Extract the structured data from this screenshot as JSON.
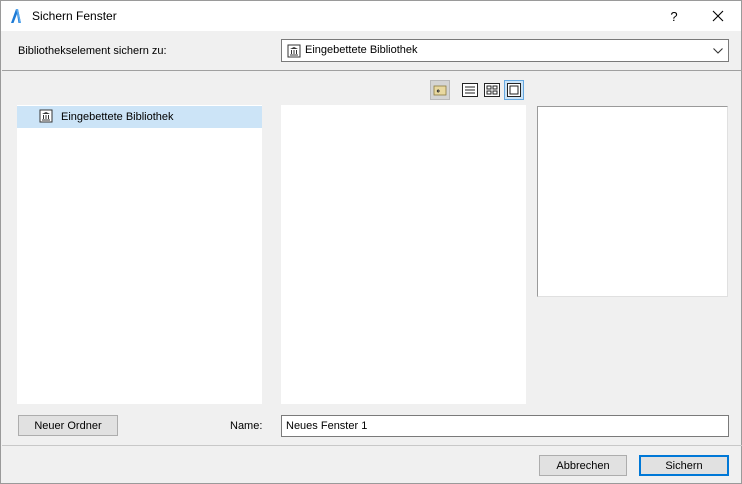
{
  "window": {
    "title": "Sichern Fenster",
    "help_label": "?",
    "close_label": "✕"
  },
  "saveto": {
    "label": "Bibliothekselement sichern zu:",
    "selected": "Eingebettete Bibliothek"
  },
  "tree": {
    "items": [
      {
        "label": "Eingebettete Bibliothek",
        "selected": true
      }
    ]
  },
  "view_buttons": {
    "up": "folder-up-icon",
    "list": "list-view-icon",
    "icons": "icon-view-icon",
    "preview": "preview-view-icon",
    "active": "preview"
  },
  "buttons": {
    "new_folder": "Neuer Ordner",
    "cancel": "Abbrechen",
    "save": "Sichern"
  },
  "name": {
    "label": "Name:",
    "value": "Neues Fenster 1"
  },
  "colors": {
    "selection": "#cce4f7",
    "accent": "#0078d7",
    "app_icon": "#1e7bd6"
  }
}
